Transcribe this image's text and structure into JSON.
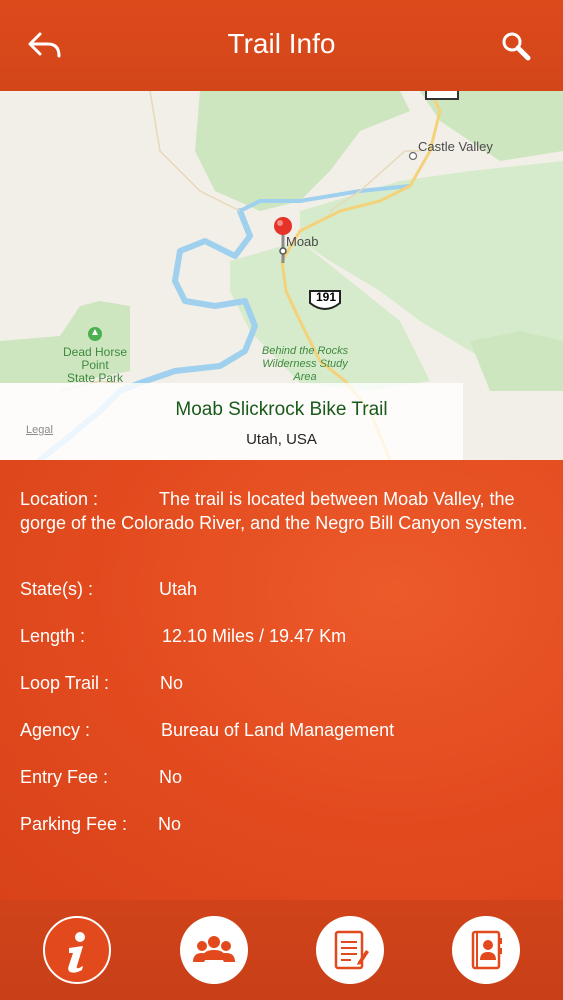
{
  "header": {
    "title": "Trail Info",
    "back_icon": "back-arrow-icon",
    "search_icon": "search-icon"
  },
  "map": {
    "places": {
      "castle_valley": "Castle Valley",
      "moab": "Moab",
      "route": "191"
    },
    "park_label": [
      "Dead Horse",
      "Point",
      "State Park"
    ],
    "wilderness_label": [
      "Behind the Rocks",
      "Wilderness Study",
      "Area"
    ],
    "legal": "Legal",
    "trail_name": "Moab Slickrock Bike Trail",
    "trail_location": "Utah, USA",
    "pin_icon": "map-pin-icon"
  },
  "details": {
    "location": {
      "label": "Location  :",
      "value": "The trail is located between Moab Valley, the gorge of the Colorado River, and the Negro Bill Canyon system."
    },
    "states": {
      "label": "State(s)  :",
      "value": "Utah"
    },
    "length": {
      "label": "Length  :",
      "value": "12.10 Miles / 19.47 Km"
    },
    "loop": {
      "label": "Loop Trail  :",
      "value": "No"
    },
    "agency": {
      "label": "Agency  :",
      "value": "Bureau of Land Management"
    },
    "entry_fee": {
      "label": "Entry Fee  :",
      "value": "No"
    },
    "parking_fee": {
      "label": "Parking Fee  :",
      "value": "No"
    }
  },
  "tabbar": {
    "tabs": [
      {
        "icon": "info-icon",
        "active": true
      },
      {
        "icon": "group-icon",
        "active": false
      },
      {
        "icon": "notepad-icon",
        "active": false
      },
      {
        "icon": "contact-book-icon",
        "active": false
      }
    ]
  },
  "colors": {
    "accent": "#e24a1e",
    "header": "#d3461a",
    "map_green": "#cde6c0",
    "water": "#9fd0ee"
  }
}
